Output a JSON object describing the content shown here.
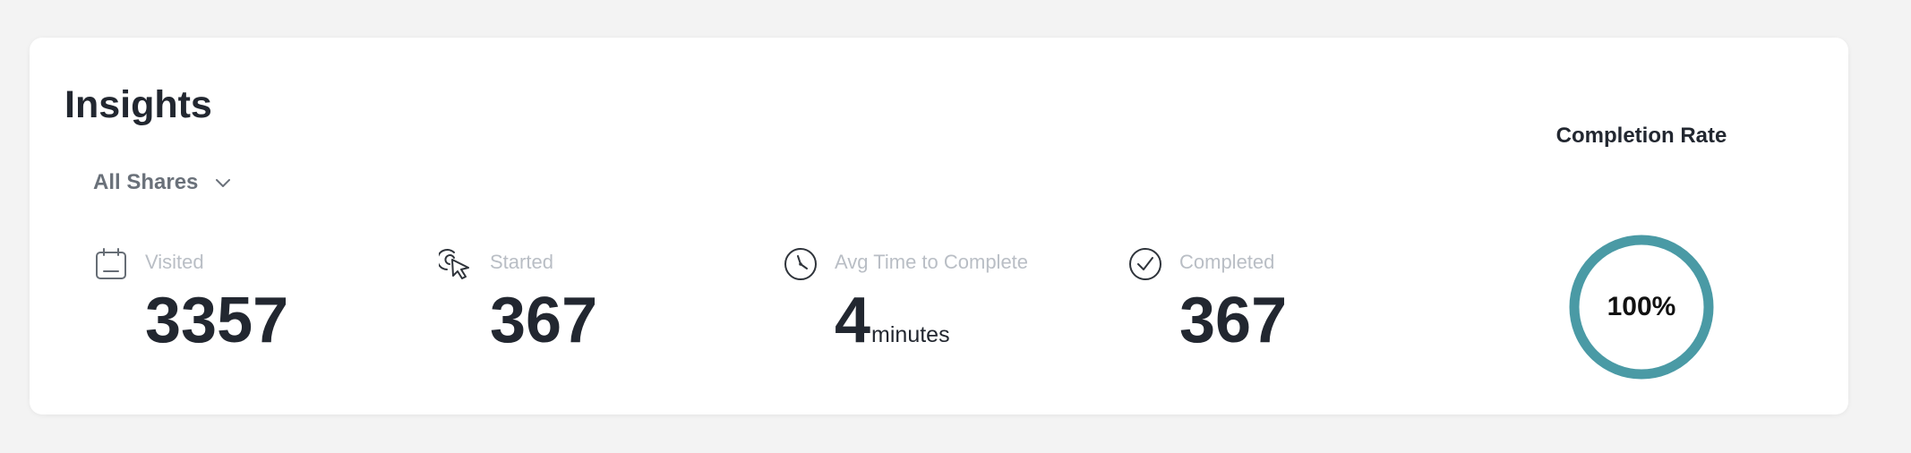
{
  "insights": {
    "title": "Insights",
    "filter": {
      "selected": "All Shares",
      "icon": "chevron-down-icon"
    },
    "metrics": [
      {
        "label": "Visited",
        "value": "3357",
        "unit": "",
        "icon": "calendar-icon"
      },
      {
        "label": "Started",
        "value": "367",
        "unit": "",
        "icon": "cursor-click-icon"
      },
      {
        "label": "Avg Time to Complete",
        "value": "4",
        "unit": "minutes",
        "icon": "clock-icon"
      },
      {
        "label": "Completed",
        "value": "367",
        "unit": "",
        "icon": "check-circle-icon"
      }
    ],
    "completion": {
      "title": "Completion Rate",
      "value_text": "100%",
      "percent": 100,
      "color": "#4a9aa5"
    }
  },
  "colors": {
    "background": "#f3f3f3",
    "card": "#ffffff",
    "text_primary": "#222730",
    "text_muted": "#b9bec5",
    "accent": "#4a9aa5"
  }
}
